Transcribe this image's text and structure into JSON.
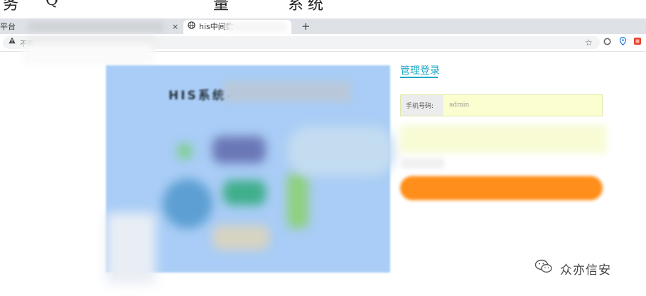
{
  "browser": {
    "tabs": [
      {
        "label": "平台",
        "close": "×"
      },
      {
        "label": "his中间数",
        "close": ""
      }
    ],
    "new_tab": "+",
    "address_prefix": "不安",
    "warn_icon": "warning-icon",
    "toolbar_icons": [
      "star-icon",
      "circle-icon",
      "location-pin-icon",
      "extension-icon"
    ],
    "top_glyphs": [
      "务",
      "Q",
      "量",
      "系",
      "统"
    ]
  },
  "left_panel": {
    "title": "HIS系统-",
    "bg_color": "#a9cdf6"
  },
  "login": {
    "heading": "管理登录",
    "phone_label": "手机号码:",
    "phone_value": "admin",
    "accent_color": "#1fa8c9",
    "button_color": "#ff8e1a"
  },
  "watermark": {
    "text": "众亦信安",
    "icon": "wechat-icon"
  }
}
